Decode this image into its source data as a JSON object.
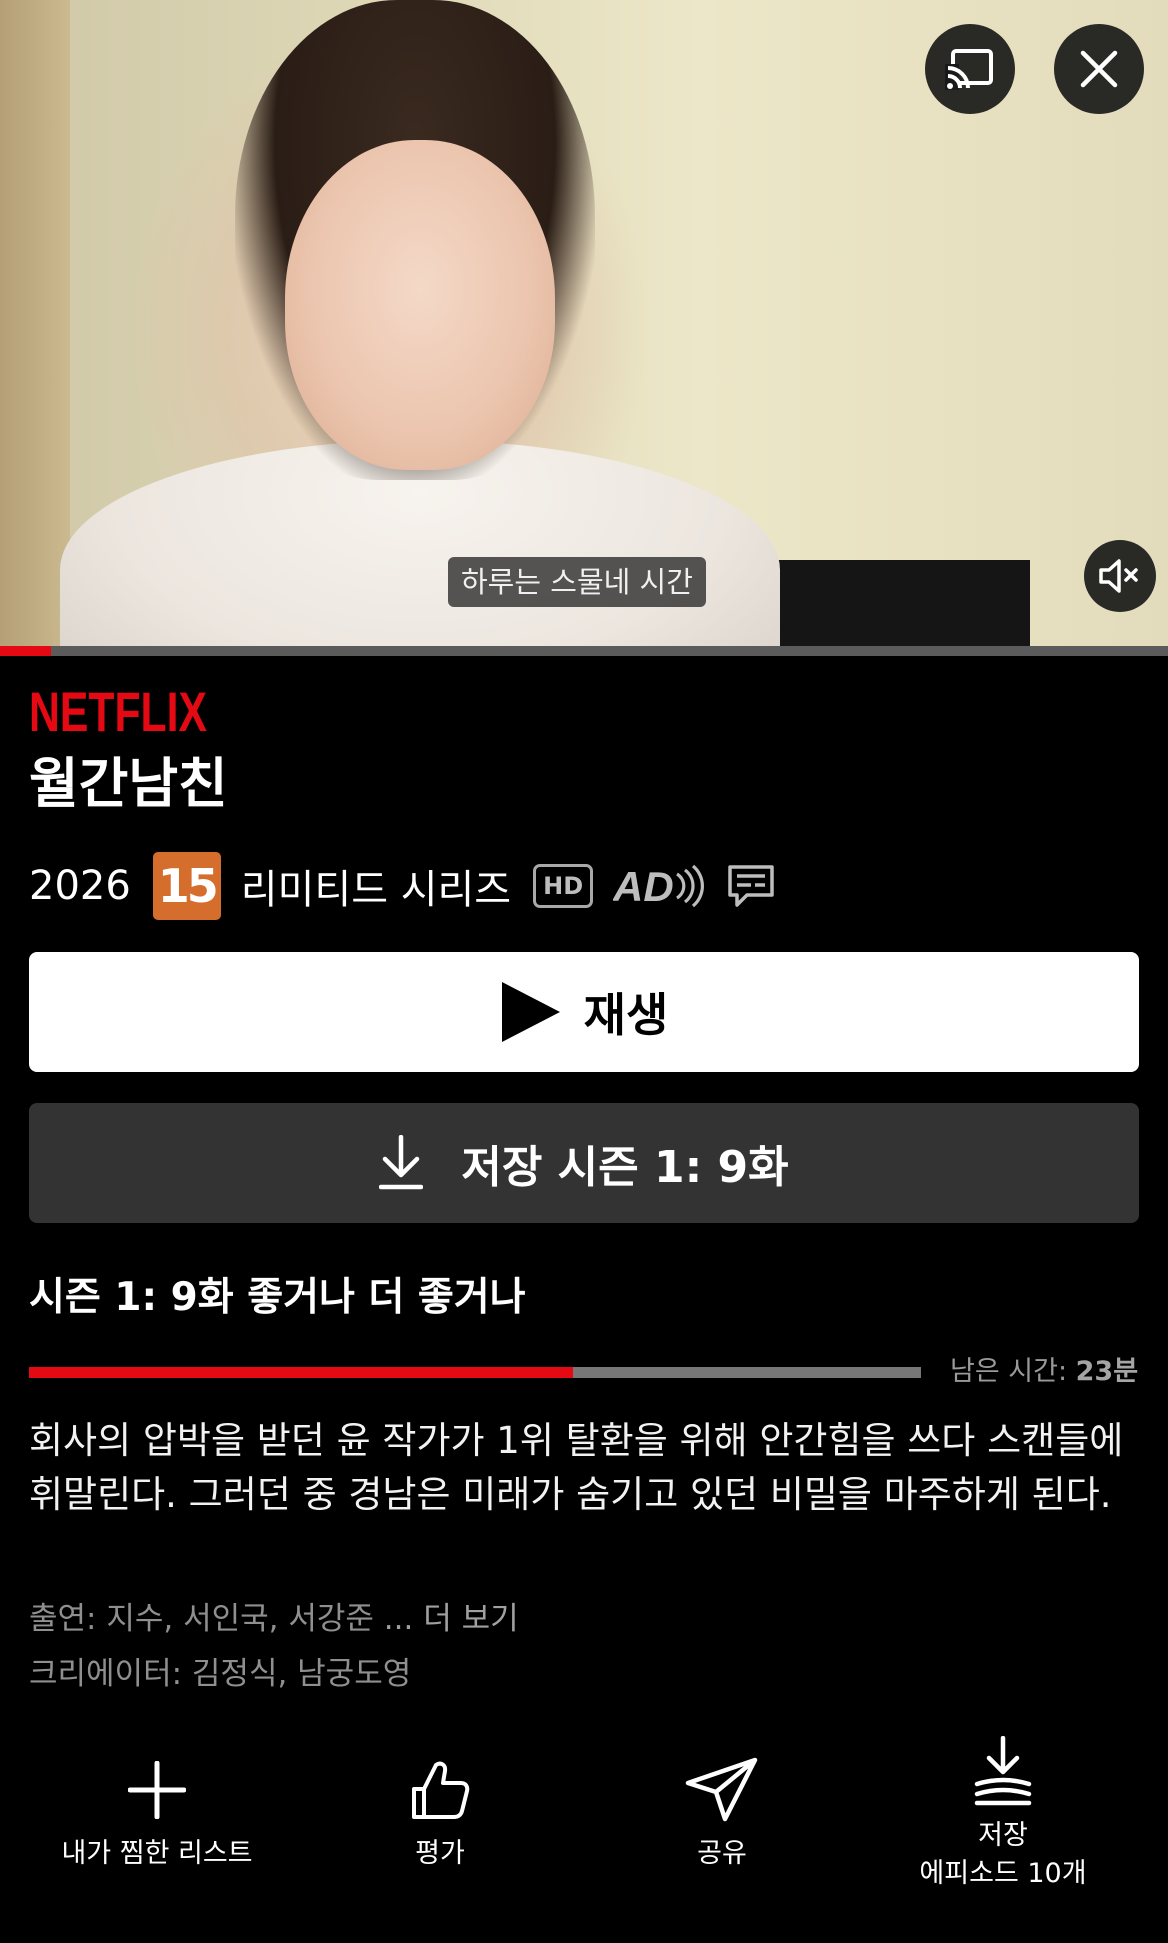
{
  "video": {
    "subtitle": "하루는 스물네 시간",
    "progress_fraction": 0.044,
    "cast_icon": "cast-icon",
    "close_icon": "close-icon",
    "mute_icon": "muted-speaker-icon"
  },
  "brand": {
    "logo_text": "NETFLIX",
    "color": "#e50914"
  },
  "show": {
    "title": "월간남친",
    "year": "2026",
    "rating": "15",
    "rating_color": "#d56d2d",
    "type": "리미티드 시리즈",
    "hd_badge": "HD",
    "ad_badge": "AD",
    "subtitles_icon": "subtitles-icon"
  },
  "buttons": {
    "play_label": "재생",
    "download_label": "저장 시즌 1: 9화"
  },
  "episode": {
    "title": "시즌 1: 9화 좋거나 더 좋거나",
    "progress_fraction": 0.61,
    "remaining_prefix": "남은 시간:",
    "remaining_value": "23분",
    "synopsis": "회사의 압박을 받던 윤 작가가 1위 탈환을 위해 안간힘을 쓰다 스캔들에 휘말린다. 그러던 중 경남은 미래가 숨기고 있던 비밀을 마주하게 된다."
  },
  "credits": {
    "cast": "출연: 지수, 서인국, 서강준",
    "more": "... 더 보기",
    "creators": "크리에이터: 김정식, 남궁도영"
  },
  "actions": [
    {
      "label": "내가 찜한 리스트",
      "icon": "plus-icon"
    },
    {
      "label": "평가",
      "icon": "thumbs-up-icon"
    },
    {
      "label": "공유",
      "icon": "share-icon"
    },
    {
      "label": "저장",
      "sublabel": "에피소드 10개",
      "icon": "download-episodes-icon"
    }
  ]
}
